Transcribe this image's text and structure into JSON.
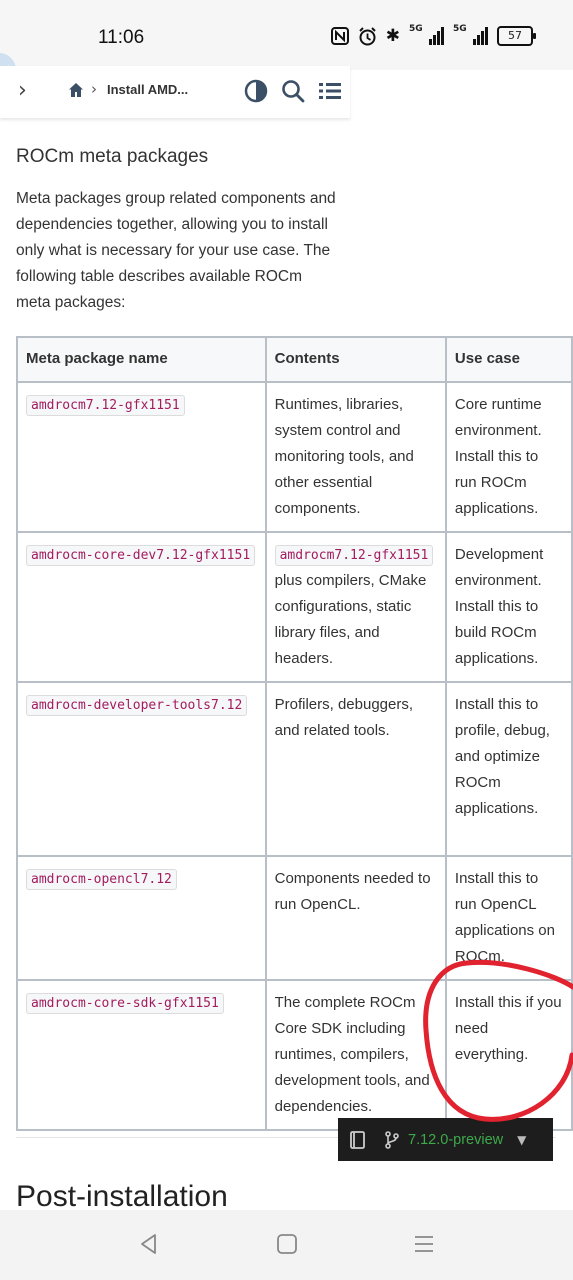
{
  "status_bar": {
    "time": "11:06",
    "icons": [
      "nfc-icon",
      "alarm-icon",
      "bluetooth-icon",
      "signal-5g-icon",
      "signal-5g-icon"
    ],
    "signal_label": "5G",
    "battery": "57"
  },
  "top_nav": {
    "icons": [
      "chevron-right-icon",
      "home-icon",
      "theme-toggle-icon",
      "search-icon",
      "list-icon"
    ],
    "breadcrumb_label": "Install AMD..."
  },
  "section": {
    "title": "ROCm meta packages",
    "intro": "Meta packages group related components and dependencies together, allowing you to install only what is necessary for your use case. The following table describes available ROCm meta packages:"
  },
  "table": {
    "headers": [
      "Meta package name",
      "Contents",
      "Use case"
    ],
    "rows": [
      {
        "package": "amdrocm7.12-gfx1151",
        "contents_code": "",
        "contents": "Runtimes, libraries, system control and monitoring tools, and other essential components.",
        "use_case": "Core runtime environment. Install this to run ROCm applications."
      },
      {
        "package": "amdrocm-core-dev7.12-gfx1151",
        "contents_code": "amdrocm7.12-gfx1151",
        "contents": "plus compilers, CMake configurations, static library files, and headers.",
        "use_case": "Development environment. Install this to build ROCm applications."
      },
      {
        "package": "amdrocm-developer-tools7.12",
        "contents_code": "",
        "contents": "Profilers, debuggers, and related tools.",
        "use_case": "Install this to profile, debug, and optimize ROCm applications."
      },
      {
        "package": "amdrocm-opencl7.12",
        "contents_code": "",
        "contents": "Components needed to run OpenCL.",
        "use_case": "Install this to run OpenCL applications on ROCm."
      },
      {
        "package": "amdrocm-core-sdk-gfx1151",
        "contents_code": "",
        "contents": "The complete ROCm Core SDK including runtimes, compilers, development tools, and dependencies.",
        "use_case": "Install this if you need everything."
      }
    ]
  },
  "next_section": {
    "title": "Post-installation"
  },
  "version_switcher": {
    "label": "7.12.0-preview",
    "icons": [
      "book-icon",
      "branch-icon",
      "caret-down-icon"
    ],
    "accent": "#3ea94b"
  },
  "annotation": {
    "color": "#e0232e"
  },
  "nav_bar": {
    "icons": [
      "back-icon",
      "home-square-icon",
      "menu-icon"
    ]
  }
}
